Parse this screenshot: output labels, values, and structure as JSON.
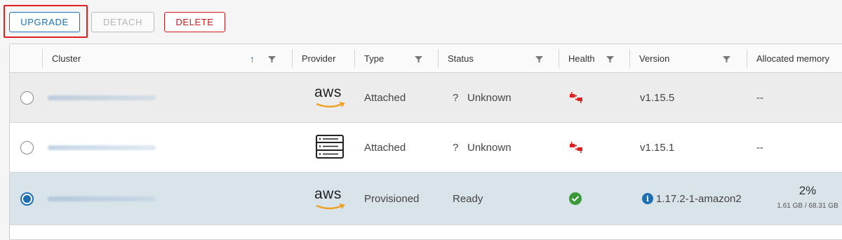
{
  "toolbar": {
    "upgrade_label": "UPGRADE",
    "detach_label": "DETACH",
    "delete_label": "DELETE"
  },
  "table": {
    "columns": [
      "Cluster",
      "Provider",
      "Type",
      "Status",
      "Health",
      "Version",
      "Allocated memory"
    ],
    "rows": [
      {
        "provider": "aws",
        "type": "Attached",
        "status_icon": "?",
        "status": "Unknown",
        "health": "disconnected-icon",
        "version": "v1.15.5",
        "memory": "--"
      },
      {
        "provider": "server",
        "type": "Attached",
        "status_icon": "?",
        "status": "Unknown",
        "health": "disconnected-icon",
        "version": "v1.15.1",
        "memory": "--"
      },
      {
        "provider": "aws",
        "type": "Provisioned",
        "status": "Ready",
        "health": "check-icon",
        "version": "1.17.2-1-amazon2",
        "memory_pct": "2%",
        "memory_detail": "1.61 GB / 68.31 GB"
      }
    ]
  },
  "colors": {
    "accent": "#1d6fb3",
    "danger": "#d0191e",
    "selected_row": "#d9e3ea",
    "health_bad": "#e02020",
    "health_ok": "#3a9a3a"
  }
}
